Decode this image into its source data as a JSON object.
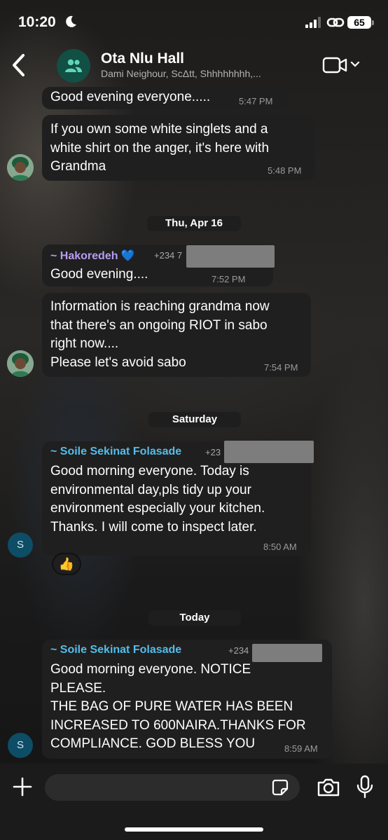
{
  "status_bar": {
    "time": "10:20",
    "battery": "65"
  },
  "header": {
    "title": "Ota Nlu Hall",
    "subtitle": "Dami Neighour, ScΔtt, Shhhhhhhh,..."
  },
  "messages": [
    {
      "text": "Good evening everyone.....",
      "time": "5:47 PM"
    },
    {
      "text": "If you own some white singlets and a\nwhite shirt on the anger, it's here with\nGrandma",
      "time": "5:48 PM"
    },
    {
      "date": "Thu, Apr 16"
    },
    {
      "sender": "~ Hakoredeh 💙",
      "phone": "+234 7",
      "text": "Good evening....",
      "time": "7:52 PM"
    },
    {
      "text": "Information is reaching grandma now\nthat there's an ongoing RIOT in sabo\nright now....\nPlease let's avoid sabo",
      "time": "7:54 PM"
    },
    {
      "date": "Saturday"
    },
    {
      "sender": "~ Soile Sekinat Folasade",
      "phone": "+23",
      "text": "Good morning everyone. Today is\nenvironmental day,pls tidy up your\nenvironment especially your kitchen.\nThanks. I will come to inspect later.",
      "time": "8:50 AM",
      "avatar_letter": "S",
      "reaction": "👍"
    },
    {
      "date": "Today"
    },
    {
      "sender": "~ Soile Sekinat Folasade",
      "phone": "+234",
      "text": "Good morning everyone. NOTICE\nPLEASE.\nTHE BAG OF PURE WATER HAS BEEN\nINCREASED TO 600NAIRA.THANKS FOR\nCOMPLIANCE. GOD BLESS YOU",
      "time": "8:59 AM",
      "avatar_letter": "S"
    }
  ],
  "composer": {
    "placeholder": ""
  },
  "colors": {
    "sender_hakoredeh": "#b79cf0",
    "sender_soile": "#53bdeb",
    "bubble": "#1f1f1f",
    "date_chip": "#1e1e1e"
  },
  "icons": [
    "moon-icon",
    "signal-icon",
    "link-icon",
    "back-icon",
    "group-icon",
    "video-icon",
    "chevron-down-icon",
    "plus-icon",
    "sticker-icon",
    "camera-icon",
    "mic-icon"
  ]
}
